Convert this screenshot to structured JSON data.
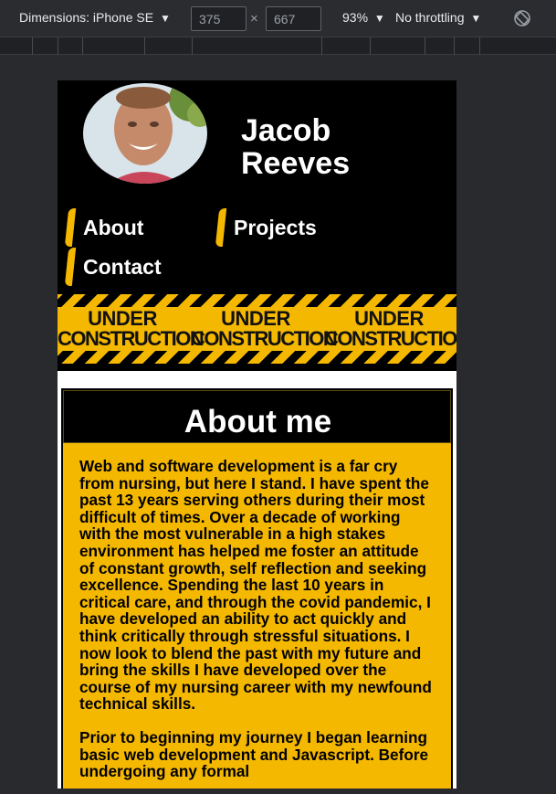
{
  "devtools": {
    "dimensions_label": "Dimensions: iPhone SE",
    "width_value": "375",
    "height_value": "667",
    "times_symbol": "×",
    "zoom": "93%",
    "throttling": "No throttling",
    "caret": "▼"
  },
  "site": {
    "name_line1": "Jacob",
    "name_line2": "Reeves",
    "nav": [
      {
        "label": "About"
      },
      {
        "label": "Projects"
      },
      {
        "label": "Contact"
      }
    ],
    "banner": {
      "line1": "UNDER",
      "line2": "CONSTRUCTION"
    },
    "about": {
      "title": "About me",
      "paragraph1": "Web and software development is a far cry from nursing, but here I stand. I have spent the past 13 years serving others during their most difficult of times. Over a decade of working with the most vulnerable in a high stakes environment has helped me foster an attitude of constant growth, self reflection and seeking excellence. Spending the last 10 years in critical care, and through the covid pandemic, I have developed an ability to act quickly and think critically through stressful situations. I now look to blend the past with my future and bring the skills I have developed over the course of my nursing career with my newfound technical skills.",
      "paragraph2": "Prior to beginning my journey I began learning basic web development and Javascript. Before undergoing any formal"
    }
  },
  "colors": {
    "accent": "#f5b800",
    "header_bg": "#000000",
    "devtools_bg": "#292a2d"
  }
}
